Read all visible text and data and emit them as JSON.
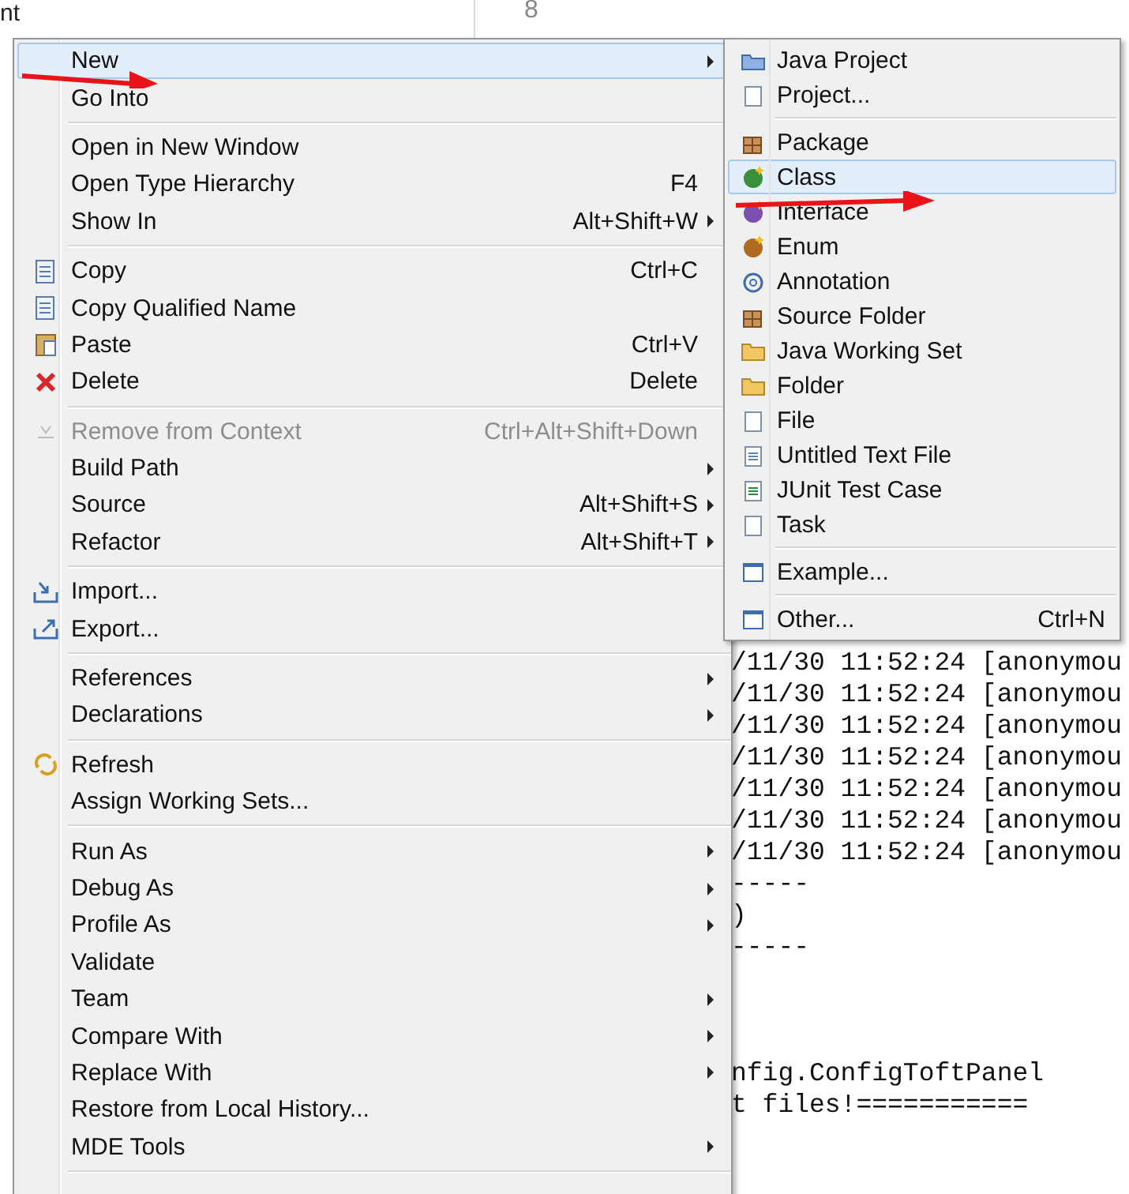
{
  "editor": {
    "line_number": "8"
  },
  "explorer": {
    "fragment": "nt"
  },
  "console": {
    "lines": [
      "/11/30 11:52:24 [anonymou",
      "/11/30 11:52:24 [anonymou",
      "/11/30 11:52:24 [anonymou",
      "/11/30 11:52:24 [anonymou",
      "/11/30 11:52:24 [anonymou",
      "/11/30 11:52:24 [anonymou",
      "/11/30 11:52:24 [anonymou",
      "-----",
      ")",
      "-----"
    ],
    "lower_lines": [
      "nfig.ConfigToftPanel",
      "t files!==========="
    ]
  },
  "context_menu": {
    "items": [
      {
        "kind": "item",
        "label": "New",
        "submenu": true,
        "selected": true,
        "disabled": false
      },
      {
        "kind": "item",
        "label": "Go Into",
        "submenu": false,
        "selected": false,
        "disabled": false
      },
      {
        "kind": "separator"
      },
      {
        "kind": "item",
        "label": "Open in New Window",
        "submenu": false,
        "selected": false,
        "disabled": false
      },
      {
        "kind": "item",
        "label": "Open Type Hierarchy",
        "shortcut": "F4",
        "submenu": false,
        "selected": false,
        "disabled": false
      },
      {
        "kind": "item",
        "label": "Show In",
        "shortcut": "Alt+Shift+W",
        "submenu": true,
        "selected": false,
        "disabled": false
      },
      {
        "kind": "separator"
      },
      {
        "kind": "item",
        "label": "Copy",
        "shortcut": "Ctrl+C",
        "submenu": false,
        "selected": false,
        "disabled": false
      },
      {
        "kind": "item",
        "label": "Copy Qualified Name",
        "submenu": false,
        "selected": false,
        "disabled": false
      },
      {
        "kind": "item",
        "label": "Paste",
        "shortcut": "Ctrl+V",
        "submenu": false,
        "selected": false,
        "disabled": false
      },
      {
        "kind": "item",
        "label": "Delete",
        "shortcut": "Delete",
        "submenu": false,
        "selected": false,
        "disabled": false
      },
      {
        "kind": "separator"
      },
      {
        "kind": "item",
        "label": "Remove from Context",
        "shortcut": "Ctrl+Alt+Shift+Down",
        "submenu": false,
        "selected": false,
        "disabled": true
      },
      {
        "kind": "item",
        "label": "Build Path",
        "submenu": true,
        "selected": false,
        "disabled": false
      },
      {
        "kind": "item",
        "label": "Source",
        "shortcut": "Alt+Shift+S",
        "submenu": true,
        "selected": false,
        "disabled": false
      },
      {
        "kind": "item",
        "label": "Refactor",
        "shortcut": "Alt+Shift+T",
        "submenu": true,
        "selected": false,
        "disabled": false
      },
      {
        "kind": "separator"
      },
      {
        "kind": "item",
        "label": "Import...",
        "submenu": false,
        "selected": false,
        "disabled": false
      },
      {
        "kind": "item",
        "label": "Export...",
        "submenu": false,
        "selected": false,
        "disabled": false
      },
      {
        "kind": "separator"
      },
      {
        "kind": "item",
        "label": "References",
        "submenu": true,
        "selected": false,
        "disabled": false
      },
      {
        "kind": "item",
        "label": "Declarations",
        "submenu": true,
        "selected": false,
        "disabled": false
      },
      {
        "kind": "separator"
      },
      {
        "kind": "item",
        "label": "Refresh",
        "submenu": false,
        "selected": false,
        "disabled": false
      },
      {
        "kind": "item",
        "label": "Assign Working Sets...",
        "submenu": false,
        "selected": false,
        "disabled": false
      },
      {
        "kind": "separator"
      },
      {
        "kind": "item",
        "label": "Run As",
        "submenu": true,
        "selected": false,
        "disabled": false
      },
      {
        "kind": "item",
        "label": "Debug As",
        "submenu": true,
        "selected": false,
        "disabled": false
      },
      {
        "kind": "item",
        "label": "Profile As",
        "submenu": true,
        "selected": false,
        "disabled": false
      },
      {
        "kind": "item",
        "label": "Validate",
        "submenu": false,
        "selected": false,
        "disabled": false
      },
      {
        "kind": "item",
        "label": "Team",
        "submenu": true,
        "selected": false,
        "disabled": false
      },
      {
        "kind": "item",
        "label": "Compare With",
        "submenu": true,
        "selected": false,
        "disabled": false
      },
      {
        "kind": "item",
        "label": "Replace With",
        "submenu": true,
        "selected": false,
        "disabled": false
      },
      {
        "kind": "item",
        "label": "Restore from Local History...",
        "submenu": false,
        "selected": false,
        "disabled": false
      },
      {
        "kind": "item",
        "label": "MDE Tools",
        "submenu": true,
        "selected": false,
        "disabled": false
      },
      {
        "kind": "separator"
      }
    ]
  },
  "new_submenu": {
    "items": [
      {
        "kind": "item",
        "label": "Java Project",
        "selected": false
      },
      {
        "kind": "item",
        "label": "Project...",
        "selected": false
      },
      {
        "kind": "separator"
      },
      {
        "kind": "item",
        "label": "Package",
        "selected": false
      },
      {
        "kind": "item",
        "label": "Class",
        "selected": true
      },
      {
        "kind": "item",
        "label": "Interface",
        "selected": false
      },
      {
        "kind": "item",
        "label": "Enum",
        "selected": false
      },
      {
        "kind": "item",
        "label": "Annotation",
        "selected": false
      },
      {
        "kind": "item",
        "label": "Source Folder",
        "selected": false
      },
      {
        "kind": "item",
        "label": "Java Working Set",
        "selected": false
      },
      {
        "kind": "item",
        "label": "Folder",
        "selected": false
      },
      {
        "kind": "item",
        "label": "File",
        "selected": false
      },
      {
        "kind": "item",
        "label": "Untitled Text File",
        "selected": false
      },
      {
        "kind": "item",
        "label": "JUnit Test Case",
        "selected": false
      },
      {
        "kind": "item",
        "label": "Task",
        "selected": false
      },
      {
        "kind": "separator"
      },
      {
        "kind": "item",
        "label": "Example...",
        "selected": false
      },
      {
        "kind": "separator"
      },
      {
        "kind": "item",
        "label": "Other...",
        "shortcut": "Ctrl+N",
        "selected": false
      }
    ]
  }
}
